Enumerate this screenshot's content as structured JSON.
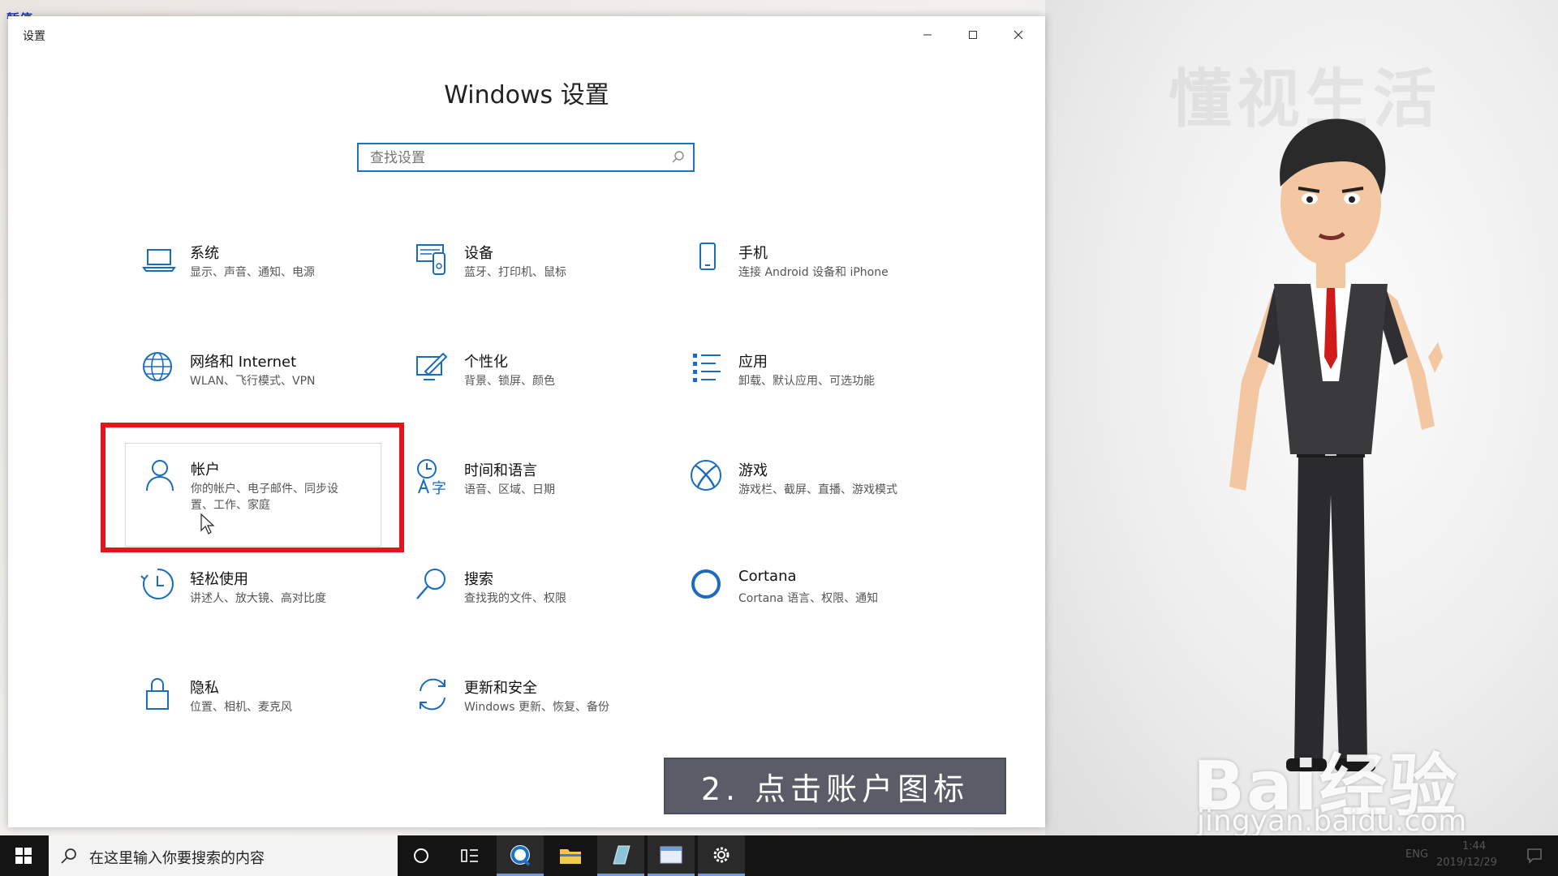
{
  "overlay": {
    "corner_label": "暂停"
  },
  "window": {
    "title": "设置",
    "heading": "Windows 设置",
    "search_placeholder": "查找设置"
  },
  "tiles": [
    {
      "id": "system",
      "name": "系统",
      "desc": "显示、声音、通知、电源",
      "icon": "laptop-icon"
    },
    {
      "id": "devices",
      "name": "设备",
      "desc": "蓝牙、打印机、鼠标",
      "icon": "devices-icon"
    },
    {
      "id": "phone",
      "name": "手机",
      "desc": "连接 Android 设备和 iPhone",
      "icon": "phone-icon"
    },
    {
      "id": "network",
      "name": "网络和 Internet",
      "desc": "WLAN、飞行模式、VPN",
      "icon": "globe-icon"
    },
    {
      "id": "personalization",
      "name": "个性化",
      "desc": "背景、锁屏、颜色",
      "icon": "paint-icon"
    },
    {
      "id": "apps",
      "name": "应用",
      "desc": "卸载、默认应用、可选功能",
      "icon": "apps-list-icon"
    },
    {
      "id": "accounts",
      "name": "帐户",
      "desc": "你的帐户、电子邮件、同步设置、工作、家庭",
      "icon": "person-icon"
    },
    {
      "id": "time",
      "name": "时间和语言",
      "desc": "语音、区域、日期",
      "icon": "time-language-icon"
    },
    {
      "id": "gaming",
      "name": "游戏",
      "desc": "游戏栏、截屏、直播、游戏模式",
      "icon": "xbox-icon"
    },
    {
      "id": "ease",
      "name": "轻松使用",
      "desc": "讲述人、放大镜、高对比度",
      "icon": "ease-of-access-icon"
    },
    {
      "id": "search",
      "name": "搜索",
      "desc": "查找我的文件、权限",
      "icon": "search-icon"
    },
    {
      "id": "cortana",
      "name": "Cortana",
      "desc": "Cortana 语言、权限、通知",
      "icon": "cortana-ring-icon"
    },
    {
      "id": "privacy",
      "name": "隐私",
      "desc": "位置、相机、麦克风",
      "icon": "lock-icon"
    },
    {
      "id": "update",
      "name": "更新和安全",
      "desc": "Windows 更新、恢复、备份",
      "icon": "sync-icon"
    }
  ],
  "caption": "2. 点击账户图标",
  "watermark": {
    "logo": "懂视生活",
    "brand": "Bai经验",
    "url": "jingyan.baidu.com"
  },
  "taskbar": {
    "search_text": "在这里输入你要搜索的内容",
    "tray_lang": "ENG",
    "tray_time": "1:44",
    "tray_date": "2019/12/29"
  },
  "colors": {
    "accent": "#1a73c9",
    "highlight": "#e4141b",
    "caption_bg": "#5a5c67"
  }
}
